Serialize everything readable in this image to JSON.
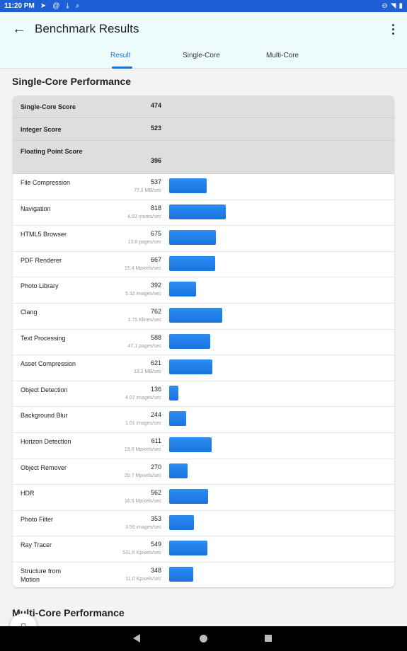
{
  "status_bar": {
    "time": "11:20 PM",
    "left_icons": [
      "telegram-icon",
      "at-icon",
      "download-icon",
      "search-icon"
    ],
    "right_icons": [
      "dnd-icon",
      "wifi-icon",
      "battery-icon"
    ]
  },
  "app_bar": {
    "title": "Benchmark Results",
    "tabs": [
      {
        "label": "Result",
        "active": true
      },
      {
        "label": "Single-Core",
        "active": false
      },
      {
        "label": "Multi-Core",
        "active": false
      }
    ]
  },
  "single_core": {
    "section_title": "Single-Core Performance",
    "summary": [
      {
        "label": "Single-Core Score",
        "value": "474"
      },
      {
        "label": "Integer Score",
        "value": "523"
      },
      {
        "label": "Floating Point Score",
        "value": "396"
      }
    ],
    "tests": [
      {
        "name": "File Compression",
        "score": "537",
        "rate": "77.2 MB/sec",
        "score_value": 537
      },
      {
        "name": "Navigation",
        "score": "818",
        "rate": "4.93 routes/sec",
        "score_value": 818
      },
      {
        "name": "HTML5 Browser",
        "score": "675",
        "rate": "13.8 pages/sec",
        "score_value": 675
      },
      {
        "name": "PDF Renderer",
        "score": "667",
        "rate": "15.4 Mpixels/sec",
        "score_value": 667
      },
      {
        "name": "Photo Library",
        "score": "392",
        "rate": "5.32 images/sec",
        "score_value": 392
      },
      {
        "name": "Clang",
        "score": "762",
        "rate": "3.75 Klines/sec",
        "score_value": 762
      },
      {
        "name": "Text Processing",
        "score": "588",
        "rate": "47.1 pages/sec",
        "score_value": 588
      },
      {
        "name": "Asset Compression",
        "score": "621",
        "rate": "19.2 MB/sec",
        "score_value": 621
      },
      {
        "name": "Object Detection",
        "score": "136",
        "rate": "4.07 images/sec",
        "score_value": 136
      },
      {
        "name": "Background Blur",
        "score": "244",
        "rate": "1.01 images/sec",
        "score_value": 244
      },
      {
        "name": "Horizon Detection",
        "score": "611",
        "rate": "19.0 Mpixels/sec",
        "score_value": 611
      },
      {
        "name": "Object Remover",
        "score": "270",
        "rate": "20.7 Mpixels/sec",
        "score_value": 270
      },
      {
        "name": "HDR",
        "score": "562",
        "rate": "16.5 Mpixels/sec",
        "score_value": 562
      },
      {
        "name": "Photo Filter",
        "score": "353",
        "rate": "3.50 images/sec",
        "score_value": 353
      },
      {
        "name": "Ray Tracer",
        "score": "549",
        "rate": "531.6 Kpixels/sec",
        "score_value": 549
      },
      {
        "name": "Structure from Motion",
        "score": "348",
        "rate": "11.0 Kpixels/sec",
        "score_value": 348
      }
    ]
  },
  "multi_core": {
    "section_title": "Multi-Core Performance"
  },
  "colors": {
    "accent": "#1e6ed8",
    "status_bar": "#1e5fd6",
    "app_bar_bg": "#eefcfe",
    "bar_fill": "#1a73e0"
  }
}
